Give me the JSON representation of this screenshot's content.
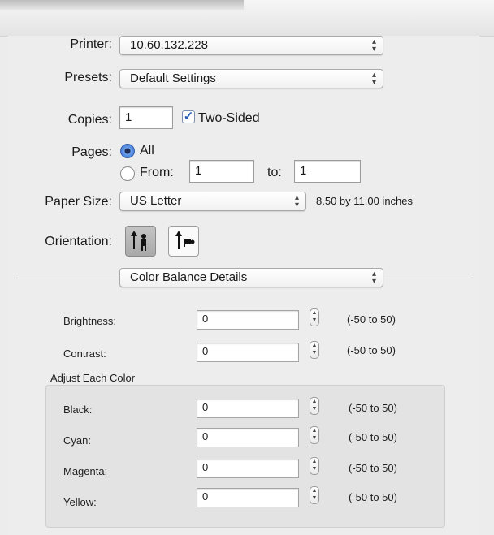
{
  "printer": {
    "label": "Printer:",
    "value": "10.60.132.228"
  },
  "presets": {
    "label": "Presets:",
    "value": "Default Settings"
  },
  "copies": {
    "label": "Copies:",
    "value": "1",
    "two_sided_label": "Two-Sided",
    "two_sided_checked": true
  },
  "pages": {
    "label": "Pages:",
    "all_label": "All",
    "from_label": "From:",
    "from_value": "1",
    "to_label": "to:",
    "to_value": "1",
    "selected": "All"
  },
  "paper_size": {
    "label": "Paper Size:",
    "value": "US Letter",
    "dimensions": "8.50 by 11.00 inches"
  },
  "orientation": {
    "label": "Orientation:",
    "selected": "portrait"
  },
  "section": {
    "value": "Color Balance Details"
  },
  "brightness": {
    "label": "Brightness:",
    "value": "0",
    "range": "(-50 to 50)"
  },
  "contrast": {
    "label": "Contrast:",
    "value": "0",
    "range": "(-50 to 50)"
  },
  "adjust_header": "Adjust Each Color",
  "colors": [
    {
      "label": "Black:",
      "value": "0",
      "range": "(-50 to 50)"
    },
    {
      "label": "Cyan:",
      "value": "0",
      "range": "(-50 to 50)"
    },
    {
      "label": "Magenta:",
      "value": "0",
      "range": "(-50 to 50)"
    },
    {
      "label": "Yellow:",
      "value": "0",
      "range": "(-50 to 50)"
    }
  ],
  "icons": {
    "popup_arrows": "up-down-arrows-icon",
    "stepper": "stepper-icon",
    "checkmark": "checkmark-icon"
  }
}
